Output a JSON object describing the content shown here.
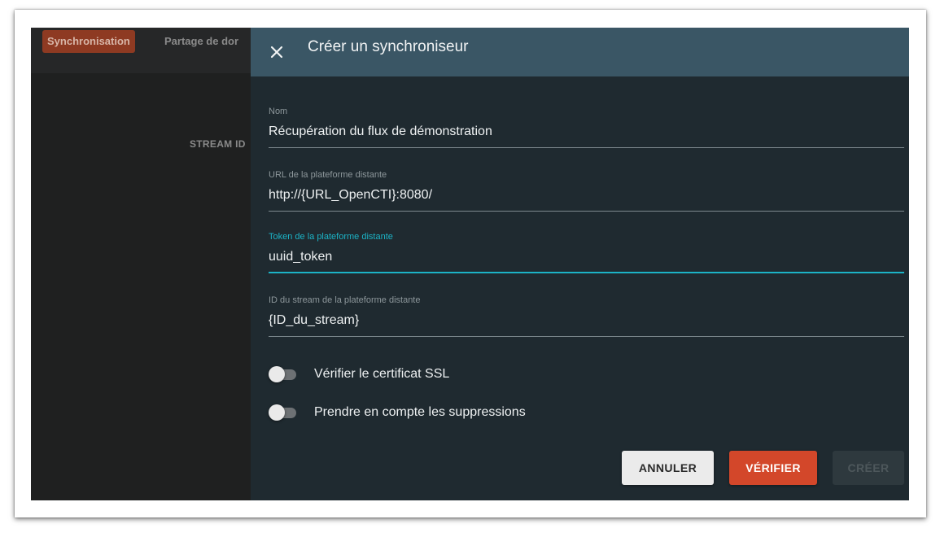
{
  "background": {
    "tabs": [
      "Synchronisation",
      "Partage de dor"
    ],
    "column_header": "STREAM ID"
  },
  "drawer": {
    "title": "Créer un synchroniseur",
    "close_icon": "close-icon",
    "fields": [
      {
        "label": "Nom",
        "value": "Récupération du flux de démonstration"
      },
      {
        "label": "URL de la plateforme distante",
        "value": "http://{URL_OpenCTI}:8080/"
      },
      {
        "label": "Token de la plateforme distante",
        "value": "uuid_token",
        "focused": true
      },
      {
        "label": "ID du stream de la plateforme distante",
        "value": "{ID_du_stream}"
      }
    ],
    "toggles": [
      {
        "label": "Vérifier le certificat SSL",
        "checked": false
      },
      {
        "label": "Prendre en compte les suppressions",
        "checked": false
      }
    ],
    "buttons": {
      "cancel": "ANNULER",
      "verify": "VÉRIFIER",
      "create": "CRÉER"
    }
  },
  "colors": {
    "header": "#3a5665",
    "drawer_bg": "#1f2a30",
    "accent_focus": "#1cb3c6",
    "primary_button": "#d3472a",
    "active_tab": "#8e3a22"
  }
}
